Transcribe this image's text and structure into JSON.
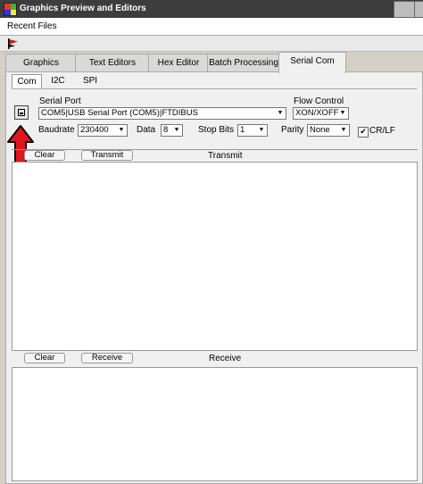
{
  "window": {
    "title": "Graphics Preview and Editors"
  },
  "menu": {
    "recent_files": "Recent Files"
  },
  "tabs": [
    {
      "label": "Graphics"
    },
    {
      "label": "Text Editors"
    },
    {
      "label": "Hex Editor"
    },
    {
      "label": "Batch Processing"
    },
    {
      "label": "Serial Com"
    }
  ],
  "subtabs": [
    {
      "label": "Com"
    },
    {
      "label": "I2C"
    },
    {
      "label": "SPI"
    }
  ],
  "serial": {
    "port_label": "Serial Port",
    "port_value": "COM5|USB Serial Port (COM5)|FTDIBUS",
    "flow_label": "Flow Control",
    "flow_value": "XON/XOFF",
    "baud_label": "Baudrate",
    "baud_value": "230400",
    "data_label": "Data",
    "data_value": "8",
    "stop_label": "Stop Bits",
    "stop_value": "1",
    "parity_label": "Parity",
    "parity_value": "None",
    "crlf_label": "CR/LF",
    "crlf_checked": true
  },
  "transmit": {
    "clear_label": "Clear",
    "button_label": "Transmit",
    "header": "Transmit"
  },
  "receive": {
    "clear_label": "Clear",
    "button_label": "Receive",
    "header": "Receive"
  },
  "colors": {
    "arrow": "#e0161c",
    "title_bg": "#3d3d3d"
  }
}
